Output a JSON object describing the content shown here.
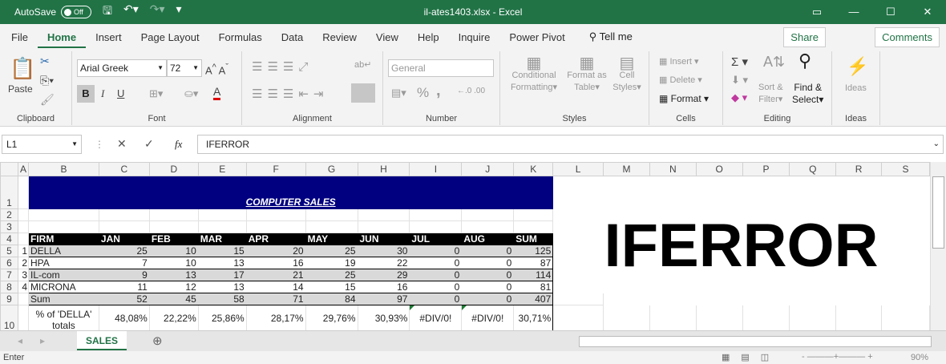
{
  "titlebar": {
    "autosave_label": "AutoSave",
    "autosave_state": "Off",
    "title": "il-ates1403.xlsx  -  Excel"
  },
  "menu": {
    "tabs": [
      "File",
      "Home",
      "Insert",
      "Page Layout",
      "Formulas",
      "Data",
      "Review",
      "View",
      "Help",
      "Inquire",
      "Power Pivot"
    ],
    "tell_me": "Tell me",
    "share": "Share",
    "comments": "Comments"
  },
  "ribbon": {
    "clipboard": {
      "paste": "Paste",
      "label": "Clipboard"
    },
    "font": {
      "name": "Arial Greek",
      "size": "72",
      "bold": "B",
      "italic": "I",
      "underline": "U",
      "font_color": "A",
      "label": "Font",
      "font_color_hex": "#e00000"
    },
    "alignment": {
      "label": "Alignment"
    },
    "number": {
      "format": "General",
      "percent": "%",
      "comma": ",",
      "label": "Number"
    },
    "styles": {
      "conditional": "Conditional",
      "formatting": "Formatting",
      "format_as": "Format as",
      "table": "Table",
      "cell": "Cell",
      "styles": "Styles",
      "label": "Styles"
    },
    "cells": {
      "insert": "Insert",
      "delete": "Delete",
      "format": "Format",
      "label": "Cells"
    },
    "editing": {
      "sort": "Sort &",
      "filter": "Filter",
      "find": "Find &",
      "select": "Select",
      "label": "Editing"
    },
    "ideas": {
      "ideas": "Ideas",
      "label": "Ideas"
    }
  },
  "formula_bar": {
    "name_box": "L1",
    "formula": "IFERROR"
  },
  "columns": [
    "A",
    "B",
    "C",
    "D",
    "E",
    "F",
    "G",
    "H",
    "I",
    "J",
    "K",
    "L",
    "M",
    "N",
    "O",
    "P",
    "Q",
    "R",
    "S"
  ],
  "sheet": {
    "title": "COMPUTER SALES",
    "headers": [
      "FIRM",
      "JAN",
      "FEB",
      "MAR",
      "APR",
      "MAY",
      "JUN",
      "JUL",
      "AUG",
      "SUM"
    ],
    "rows": [
      {
        "idx": "1",
        "firm": "DELLA",
        "vals": [
          "25",
          "10",
          "15",
          "20",
          "25",
          "30",
          "0",
          "0",
          "125"
        ]
      },
      {
        "idx": "2",
        "firm": "HPA",
        "vals": [
          "7",
          "10",
          "13",
          "16",
          "19",
          "22",
          "0",
          "0",
          "87"
        ]
      },
      {
        "idx": "3",
        "firm": "IL-com",
        "vals": [
          "9",
          "13",
          "17",
          "21",
          "25",
          "29",
          "0",
          "0",
          "114"
        ]
      },
      {
        "idx": "4",
        "firm": "MICRONA",
        "vals": [
          "11",
          "12",
          "13",
          "14",
          "15",
          "16",
          "0",
          "0",
          "81"
        ]
      }
    ],
    "sum": {
      "label": "Sum",
      "vals": [
        "52",
        "45",
        "58",
        "71",
        "84",
        "97",
        "0",
        "0",
        "407"
      ]
    },
    "pct": {
      "label": "% of 'DELLA' totals",
      "vals": [
        "48,08%",
        "22,22%",
        "25,86%",
        "28,17%",
        "29,76%",
        "30,93%",
        "#DIV/0!",
        "#DIV/0!",
        "30,71%"
      ]
    },
    "big_text": "IFERROR",
    "navy": "#000080"
  },
  "tabs": {
    "sheet": "SALES"
  },
  "status": {
    "mode": "Enter",
    "zoom": "90%"
  }
}
